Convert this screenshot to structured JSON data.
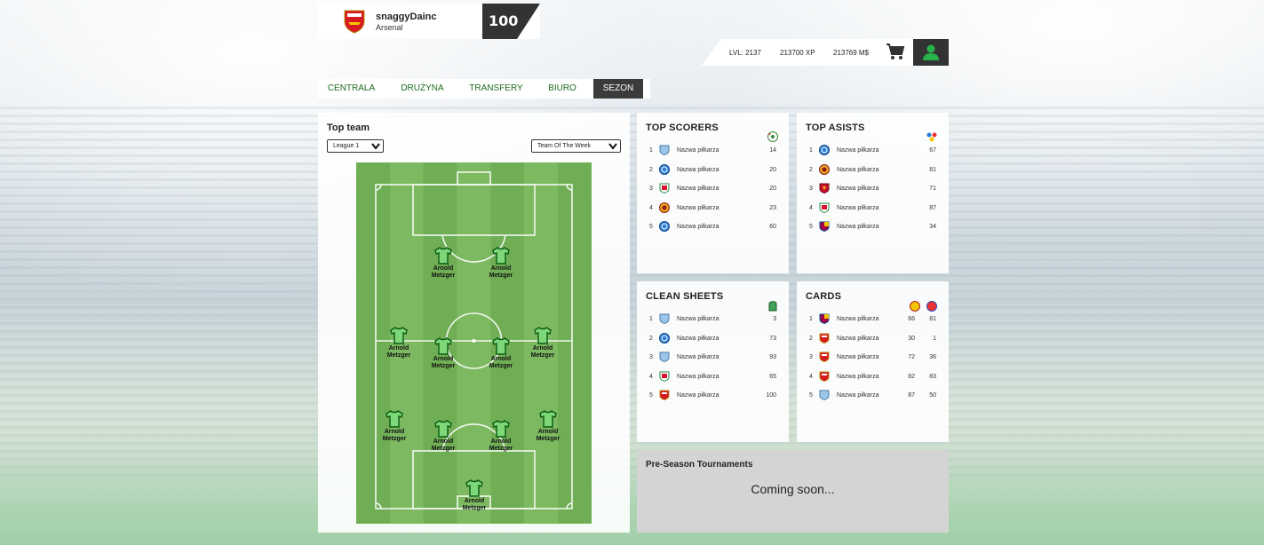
{
  "user": {
    "name": "snaggyDainc",
    "club": "Arsenal",
    "level_badge": "100"
  },
  "stats": {
    "level": "LVL: 2137",
    "xp": "213700 XP",
    "money": "213769 M$"
  },
  "icons": {
    "cart": "cart-icon",
    "profile": "user-icon"
  },
  "colors": {
    "nav_text": "#1e6b1e",
    "nav_active_bg": "#3b3b3b",
    "profile_icon": "#27b24a"
  },
  "nav": {
    "items": [
      {
        "label": "CENTRALA"
      },
      {
        "label": "DRUŻYNA"
      },
      {
        "label": "TRANSFERY"
      },
      {
        "label": "BIURO"
      },
      {
        "label": "SEZON"
      }
    ]
  },
  "top_team": {
    "title": "Top team",
    "league_select": "League 1",
    "period_select": "Team Of The Week",
    "players": [
      {
        "first": "Arnold",
        "last": "Metzger"
      },
      {
        "first": "Arnold",
        "last": "Metzger"
      },
      {
        "first": "Arnold",
        "last": "Metzger"
      },
      {
        "first": "Arnold",
        "last": "Metzger"
      },
      {
        "first": "Arnold",
        "last": "Metzger"
      },
      {
        "first": "Arnold",
        "last": "Metzger"
      },
      {
        "first": "Arnold",
        "last": "Metzger"
      },
      {
        "first": "Arnold",
        "last": "Metzger"
      },
      {
        "first": "Arnold",
        "last": "Metzger"
      },
      {
        "first": "Arnold",
        "last": "Metzger"
      },
      {
        "first": "Arnold",
        "last": "Metzger"
      }
    ]
  },
  "top_scorers": {
    "title": "TOP SCORERS",
    "rows": [
      {
        "rank": "1",
        "name": "Nazwa piłkarza",
        "value": "14"
      },
      {
        "rank": "2",
        "name": "Nazwa piłkarza",
        "value": "20"
      },
      {
        "rank": "3",
        "name": "Nazwa piłkarza",
        "value": "20"
      },
      {
        "rank": "4",
        "name": "Nazwa piłkarza",
        "value": "23"
      },
      {
        "rank": "5",
        "name": "Nazwa piłkarza",
        "value": "60"
      }
    ]
  },
  "top_asists": {
    "title": "TOP ASISTS",
    "rows": [
      {
        "rank": "1",
        "name": "Nazwa piłkarza",
        "value": "67"
      },
      {
        "rank": "2",
        "name": "Nazwa piłkarza",
        "value": "81"
      },
      {
        "rank": "3",
        "name": "Nazwa piłkarza",
        "value": "71"
      },
      {
        "rank": "4",
        "name": "Nazwa piłkarza",
        "value": "87"
      },
      {
        "rank": "5",
        "name": "Nazwa piłkarza",
        "value": "34"
      }
    ]
  },
  "clean_sheets": {
    "title": "CLEAN SHEETS",
    "rows": [
      {
        "rank": "1",
        "name": "Nazwa piłkarza",
        "value": "3"
      },
      {
        "rank": "2",
        "name": "Nazwa piłkarza",
        "value": "73"
      },
      {
        "rank": "3",
        "name": "Nazwa piłkarza",
        "value": "93"
      },
      {
        "rank": "4",
        "name": "Nazwa piłkarza",
        "value": "65"
      },
      {
        "rank": "5",
        "name": "Nazwa piłkarza",
        "value": "100"
      }
    ]
  },
  "cards": {
    "title": "CARDS",
    "rows": [
      {
        "rank": "1",
        "name": "Nazwa piłkarza",
        "yellow": "66",
        "red": "81"
      },
      {
        "rank": "2",
        "name": "Nazwa piłkarza",
        "yellow": "30",
        "red": "1"
      },
      {
        "rank": "3",
        "name": "Nazwa piłkarza",
        "yellow": "72",
        "red": "36"
      },
      {
        "rank": "4",
        "name": "Nazwa piłkarza",
        "yellow": "82",
        "red": "83"
      },
      {
        "rank": "5",
        "name": "Nazwa piłkarza",
        "yellow": "87",
        "red": "50"
      }
    ]
  },
  "tournaments": {
    "title": "Pre-Season Tournaments",
    "status": "Coming soon..."
  }
}
